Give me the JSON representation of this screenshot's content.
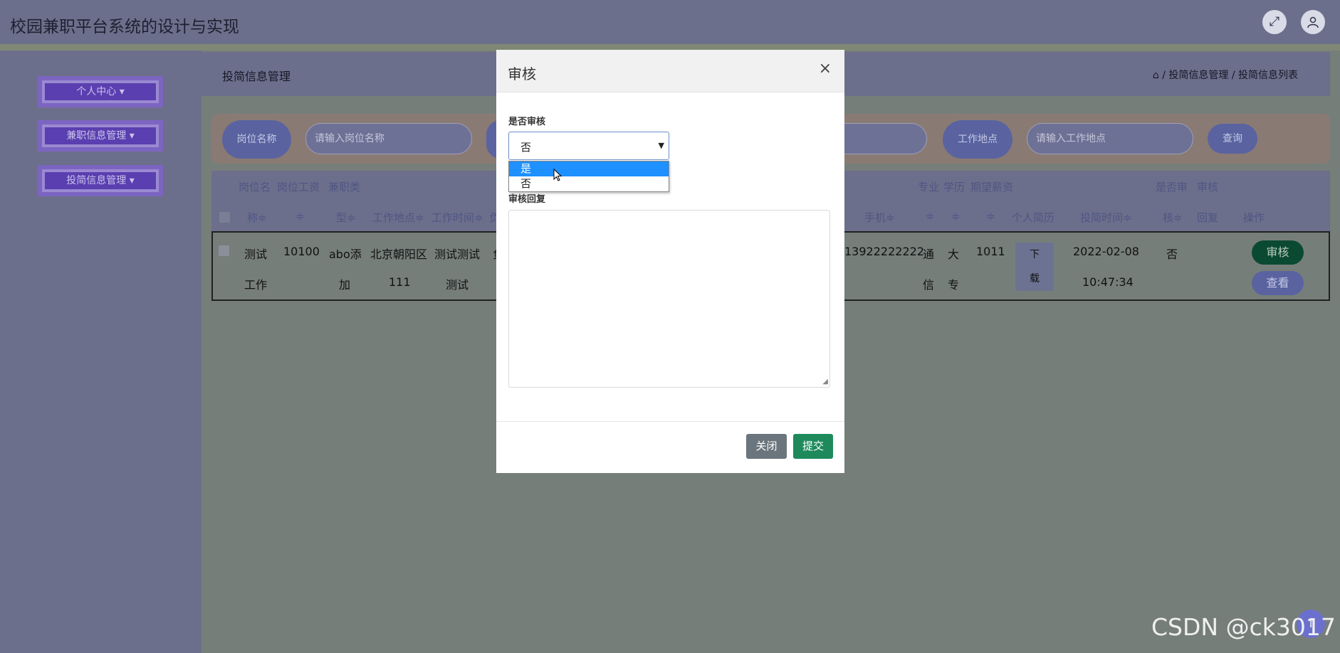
{
  "app": {
    "title": "校园兼职平台系统的设计与实现",
    "icons": {
      "fullscreen": "expand-icon",
      "user": "user-icon"
    }
  },
  "sidebar": {
    "items": [
      {
        "label": "个人中心 ▾"
      },
      {
        "label": "兼职信息管理 ▾"
      },
      {
        "label": "投简信息管理 ▾"
      }
    ]
  },
  "breadcrumb": {
    "title": "投简信息管理",
    "path": "⌂ / 投简信息管理 / 投简信息列表"
  },
  "search": {
    "position_label": "岗位名称",
    "position_placeholder": "请输入岗位名称",
    "location_label": "工作地点",
    "location_placeholder": "请输入工作地点",
    "query_label": "查询"
  },
  "table": {
    "header_top": [
      "岗位名",
      "岗位工资",
      "兼职类",
      "专业",
      "学历",
      "期望薪资",
      "是否审",
      "审核"
    ],
    "header_bottom": [
      "称≑",
      "≑",
      "型≑",
      "工作地点≑",
      "工作时间≑",
      "负",
      "手机≑",
      "≑",
      "≑",
      "≑",
      "个人简历",
      "投简时间≑",
      "核≑",
      "回复",
      "操作"
    ],
    "row": {
      "name_1": "测试",
      "name_2": "工作",
      "salary": "10100",
      "type_1": "abo添",
      "type_2": "加",
      "location_1": "北京朝阳区",
      "location_2": "111",
      "time_1": "测试测试",
      "time_2": "测试",
      "extra": "负",
      "phone": "13922222222",
      "major_1": "通",
      "major_2": "信",
      "edu_1": "大",
      "edu_2": "专",
      "expect_salary": "1011",
      "resume_1": "下",
      "resume_2": "载",
      "submit_date": "2022-02-08",
      "submit_time": "10:47:34",
      "audited": "否",
      "audit_btn": "审核",
      "view_btn": "查看"
    }
  },
  "modal": {
    "title": "审核",
    "close_icon": "×",
    "audit_label": "是否审核",
    "select_value": "否",
    "options": [
      "是",
      "否"
    ],
    "reply_label": "审核回复",
    "close_btn": "关闭",
    "submit_btn": "提交"
  },
  "watermark": "CSDN @ck3017",
  "scroll_top_icon": "↑"
}
